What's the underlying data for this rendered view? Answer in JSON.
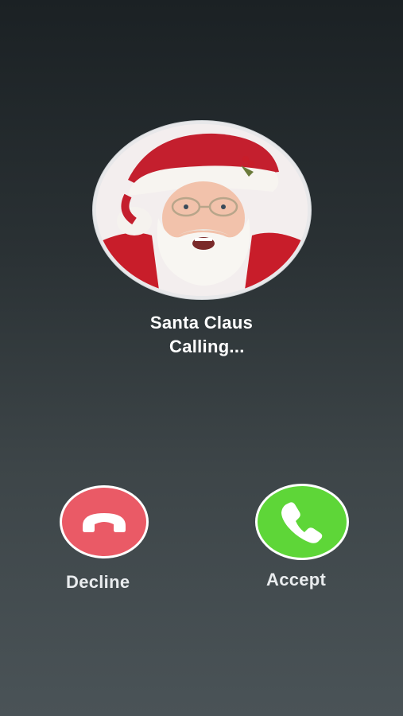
{
  "caller": {
    "name": "Santa Claus",
    "status": "Calling..."
  },
  "actions": {
    "decline_label": "Decline",
    "accept_label": "Accept"
  },
  "icons": {
    "decline": "phone-hangup-icon",
    "accept": "phone-icon"
  },
  "colors": {
    "decline": "#ea5a66",
    "accept": "#5ed638",
    "background_top": "#1b2124",
    "background_bottom": "#4a5357"
  }
}
